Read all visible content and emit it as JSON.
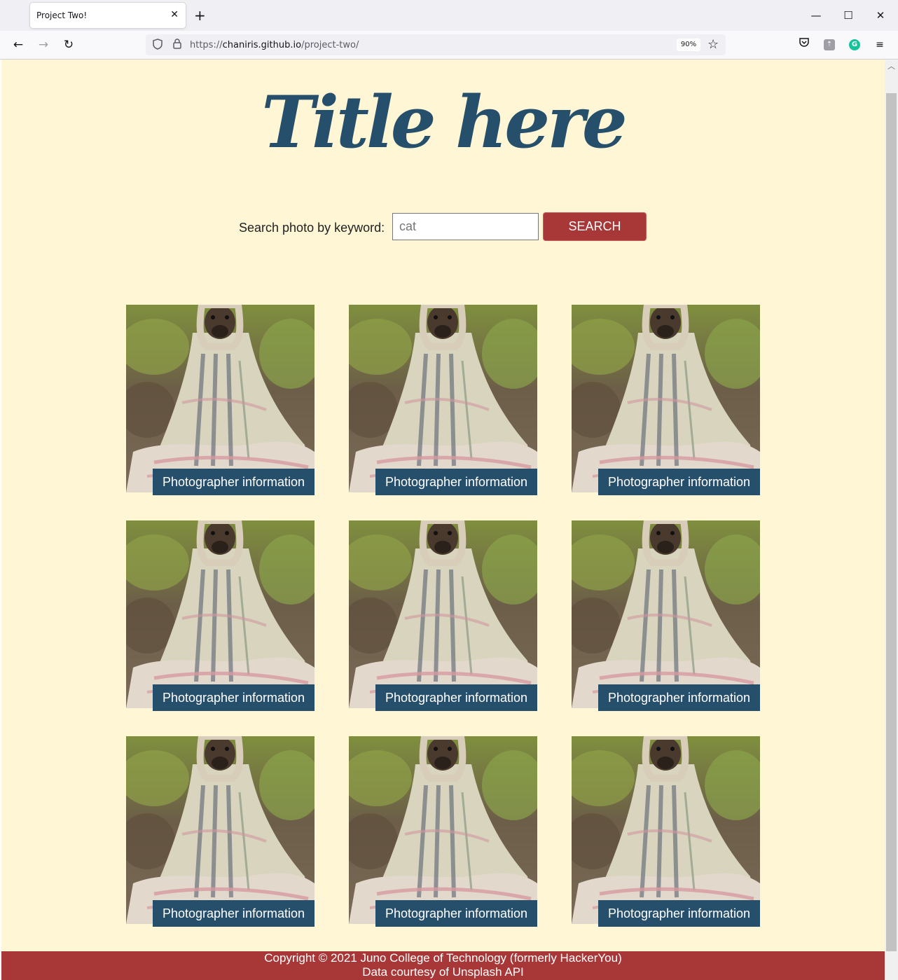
{
  "browser": {
    "tab_title": "Project Two!",
    "tab_close": "✕",
    "new_tab": "+",
    "url_scheme": "https://",
    "url_host": "chaniris.github.io",
    "url_path": "/project-two/",
    "zoom": "90%",
    "window_controls": {
      "minimize": "—",
      "maximize": "☐",
      "close": "✕"
    },
    "icons": {
      "back": "back-arrow-icon",
      "forward": "forward-arrow-icon",
      "reload": "reload-icon",
      "shield": "tracking-shield-icon",
      "lock": "lock-icon",
      "star": "bookmark-star-icon",
      "pocket": "pocket-icon",
      "extension": "extension-icon",
      "grammarly": "grammarly-icon",
      "menu": "hamburger-menu-icon"
    }
  },
  "page": {
    "title": "Title here",
    "search": {
      "label": "Search photo by keyword:",
      "value": "cat",
      "button_label": "SEARCH"
    },
    "photos": [
      {
        "caption": "Photographer information"
      },
      {
        "caption": "Photographer information"
      },
      {
        "caption": "Photographer information"
      },
      {
        "caption": "Photographer information"
      },
      {
        "caption": "Photographer information"
      },
      {
        "caption": "Photographer information"
      },
      {
        "caption": "Photographer information"
      },
      {
        "caption": "Photographer information"
      },
      {
        "caption": "Photographer information"
      }
    ],
    "footer": {
      "line1": "Copyright © 2021 Juno College of Technology (formerly HackerYou)",
      "line2": "Data courtesy of Unsplash API"
    },
    "colors": {
      "background": "#fff6d6",
      "title": "#264f6b",
      "accent_red": "#a83737",
      "caption_bg": "#264f6b"
    }
  }
}
